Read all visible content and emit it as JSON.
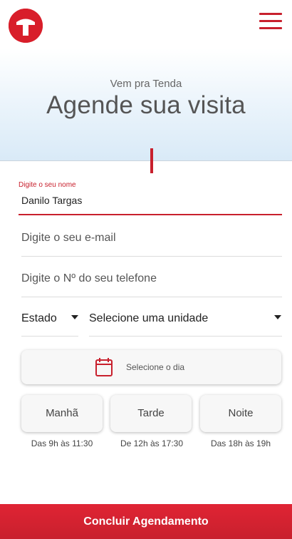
{
  "header": {
    "logo_icon": "tenda-logo-icon",
    "menu_icon": "hamburger-menu-icon",
    "accent_color": "#c8202d"
  },
  "hero": {
    "subtitle": "Vem pra Tenda",
    "title": "Agende sua visita"
  },
  "form": {
    "name": {
      "label": "Digite o seu nome",
      "value": "Danilo Targas"
    },
    "email": {
      "placeholder": "Digite o seu e-mail"
    },
    "phone": {
      "placeholder": "Digite o Nº do seu telefone"
    },
    "state_select": {
      "value": "Estado"
    },
    "unit_select": {
      "value": "Selecione uma unidade"
    },
    "day_button": {
      "label": "Selecione o dia",
      "icon": "calendar-icon"
    },
    "periods": [
      {
        "label": "Manhã",
        "hours": "Das 9h às 11:30"
      },
      {
        "label": "Tarde",
        "hours": "De 12h às 17:30"
      },
      {
        "label": "Noite",
        "hours": "Das 18h às 19h"
      }
    ],
    "submit_label": "Concluir Agendamento"
  }
}
